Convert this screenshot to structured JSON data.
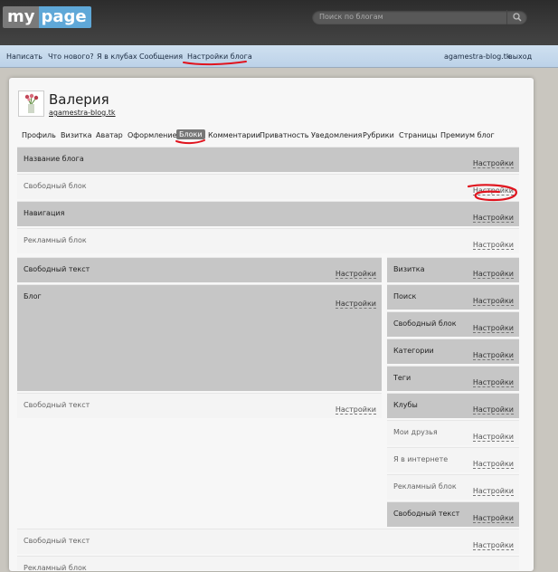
{
  "header": {
    "logo_my": "my",
    "logo_page": "page",
    "search_placeholder": "Поиск по блогам",
    "search_icon": "magnifier-icon"
  },
  "nav": {
    "items": [
      "Написать",
      "Что нового?",
      "Я в клубах",
      "Сообщения",
      "Настройки блога"
    ],
    "site": "agamestra-blog.tk",
    "logout": "выход"
  },
  "profile": {
    "name": "Валерия",
    "link": "agamestra-blog.tk"
  },
  "tabs": [
    "Профиль",
    "Визитка",
    "Аватар",
    "Оформление",
    "Блоки",
    "Комментарии",
    "Приватность",
    "Уведомления",
    "Рубрики",
    "Страницы",
    "Премиум блог"
  ],
  "active_tab": "Блоки",
  "settings_label": "Настройки",
  "blocks": {
    "blog_title": "Название блога",
    "free_block_1": "Свободный блок",
    "navigation": "Навигация",
    "ad_block_1": "Рекламный блок",
    "free_text_1": "Свободный текст",
    "blog": "Блог",
    "free_text_2": "Свободный текст",
    "free_text_3": "Свободный текст",
    "ad_block_2": "Рекламный блок"
  },
  "sidebar": {
    "vizitka": "Визитка",
    "search": "Поиск",
    "free_block": "Свободный блок",
    "categories": "Категории",
    "tags": "Теги",
    "clubs": "Клубы",
    "friends": "Мои друзья",
    "internet": "Я в интернете",
    "ad_block": "Рекламный блок",
    "free_text": "Свободный текст"
  },
  "colors": {
    "annotation": "#e0141e",
    "dark_block": "#c6c6c6",
    "nav_bg": "#cfe0f0"
  }
}
